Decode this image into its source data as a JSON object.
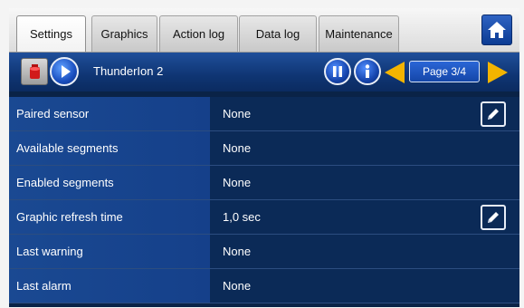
{
  "tabs": [
    {
      "label": "Settings",
      "active": true
    },
    {
      "label": "Graphics",
      "active": false
    },
    {
      "label": "Action log",
      "active": false
    },
    {
      "label": "Data log",
      "active": false
    },
    {
      "label": "Maintenance",
      "active": false
    }
  ],
  "home_icon": "home-icon",
  "header": {
    "device_name": "ThunderIon 2",
    "page_label": "Page 3/4",
    "icons": [
      "stop-icon",
      "play-icon",
      "pause-icon",
      "info-icon",
      "previous-page-arrow",
      "next-page-arrow"
    ]
  },
  "rows": [
    {
      "label": "Paired sensor",
      "value": "None",
      "editable": true
    },
    {
      "label": "Available segments",
      "value": "None",
      "editable": false
    },
    {
      "label": "Enabled segments",
      "value": "None",
      "editable": false
    },
    {
      "label": "Graphic refresh time",
      "value": "1,0 sec",
      "editable": true
    },
    {
      "label": "Last warning",
      "value": "None",
      "editable": false
    },
    {
      "label": "Last alarm",
      "value": "None",
      "editable": false
    }
  ],
  "colors": {
    "accent_arrow": "#f3b400",
    "header_blue": "#1f4f9a",
    "background": "#0a2347"
  }
}
